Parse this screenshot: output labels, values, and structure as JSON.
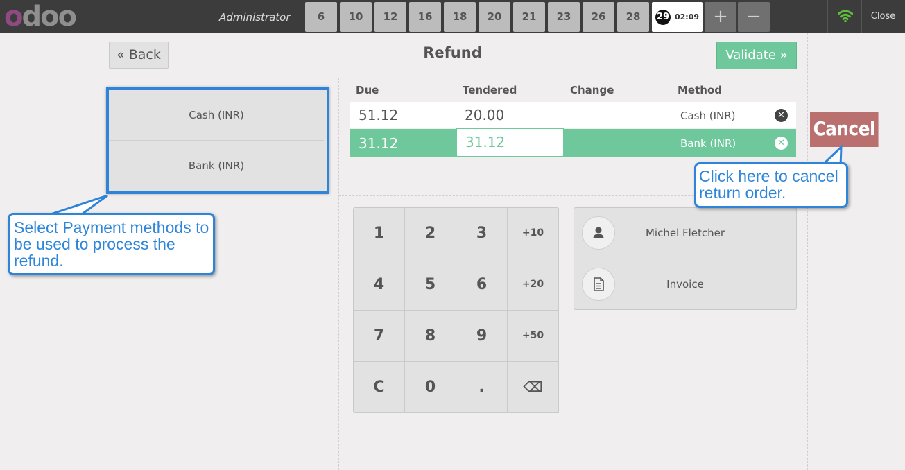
{
  "header": {
    "logo_letters": [
      "o",
      "d",
      "o",
      "o"
    ],
    "logo_colors": {
      "primary": "#8f4a84",
      "secondary": "#8f8f8f"
    },
    "user": "Administrator",
    "order_tabs": [
      "6",
      "10",
      "12",
      "16",
      "18",
      "20",
      "21",
      "23",
      "26",
      "28"
    ],
    "selected_order": {
      "number": "29",
      "time": "02:09"
    },
    "add_label": "+",
    "remove_label": "−",
    "wifi_icon": "wifi-icon",
    "close_label": "Close"
  },
  "payment_screen": {
    "back_label": "« Back",
    "title": "Refund",
    "validate_label": "Validate »",
    "methods": [
      "Cash (INR)",
      "Bank (INR)"
    ],
    "columns": {
      "due": "Due",
      "tendered": "Tendered",
      "change": "Change",
      "method": "Method"
    },
    "lines": [
      {
        "due": "51.12",
        "tendered": "20.00",
        "change": "",
        "method": "Cash (INR)",
        "selected": false
      },
      {
        "due": "31.12",
        "tendered": "31.12",
        "change": "",
        "method": "Bank (INR)",
        "selected": true
      }
    ],
    "numpad": [
      "1",
      "2",
      "3",
      "+10",
      "4",
      "5",
      "6",
      "+20",
      "7",
      "8",
      "9",
      "+50",
      "C",
      "0",
      ".",
      "⌫"
    ],
    "customer_label": "Michel Fletcher",
    "invoice_label": "Invoice"
  },
  "annotations": {
    "cancel_label": "Cancel",
    "cancel_note": "Click here to cancel return order.",
    "methods_note": "Select Payment methods to be used to process the refund."
  },
  "colors": {
    "accent_green": "#6ec89b",
    "callout_blue": "#2e84d8",
    "cancel_red": "#bb7070",
    "topbar": "#3c3c3c"
  }
}
